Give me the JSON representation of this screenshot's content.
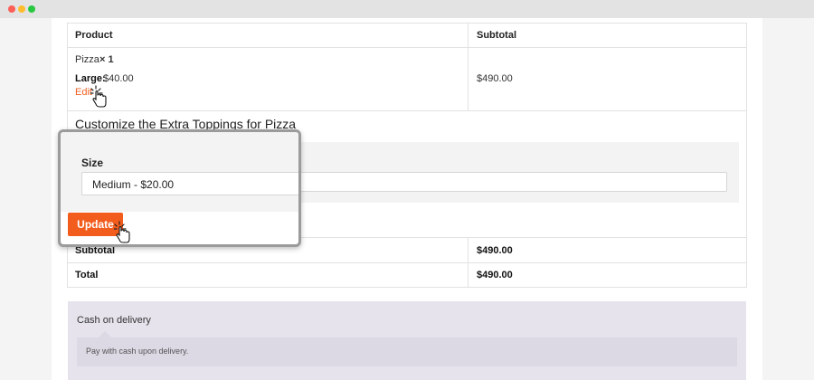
{
  "window": {
    "traffic_lights": [
      "#fe5f57",
      "#febc2e",
      "#28c840"
    ]
  },
  "table": {
    "headers": {
      "product": "Product",
      "subtotal": "Subtotal"
    },
    "item": {
      "name": "Pizza",
      "quantity": "× 1",
      "variant_label": "Large:",
      "variant_price": "$40.00",
      "edit": "Edit",
      "subtotal": "$490.00"
    },
    "customize_title": "Customize the Extra Toppings for Pizza",
    "totals": [
      {
        "label": "Subtotal",
        "value": "$490.00"
      },
      {
        "label": "Total",
        "value": "$490.00"
      }
    ]
  },
  "popup": {
    "size_label": "Size",
    "size_value": "Medium - $20.00",
    "update_button": "Update"
  },
  "payment": {
    "method": "Cash on delivery",
    "description": "Pay with cash upon delivery."
  },
  "colors": {
    "accent": "#f25c1d",
    "link": "#f06022",
    "payment_bg": "#e6e3ec"
  }
}
